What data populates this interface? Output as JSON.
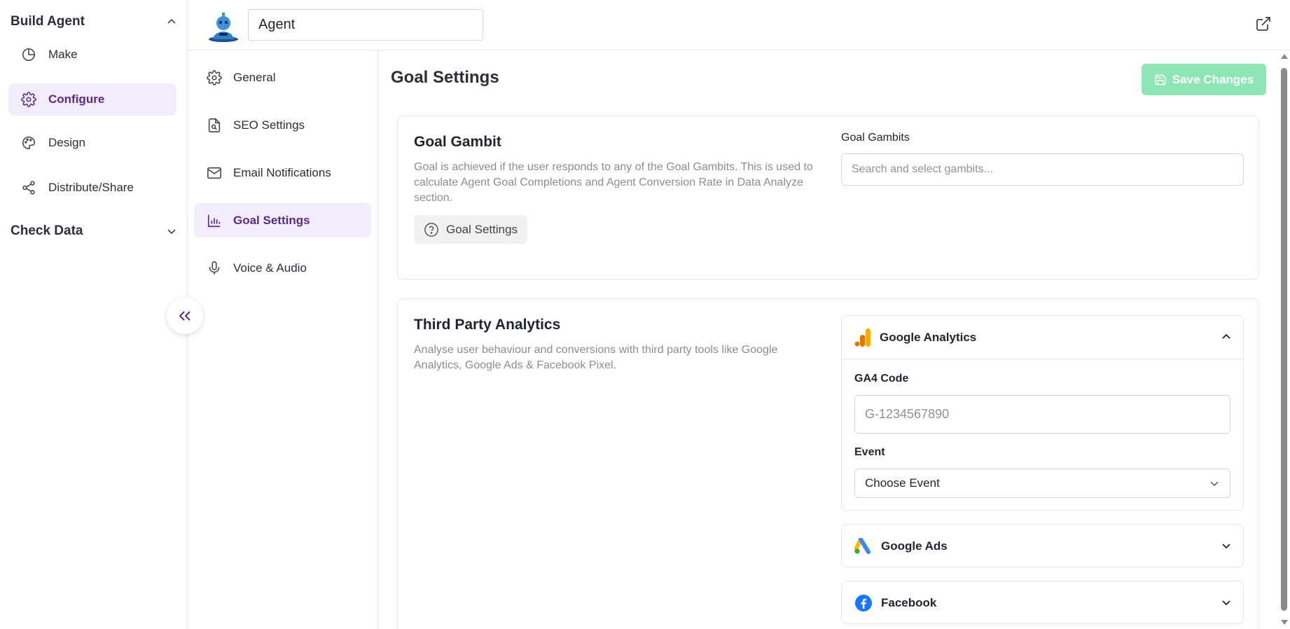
{
  "sidebar": {
    "build_agent": {
      "title": "Build Agent",
      "chevron_icon": "chevron-up-icon"
    },
    "items": [
      {
        "label": "Make",
        "icon": "pie-chart-icon"
      },
      {
        "label": "Configure",
        "icon": "gear-icon",
        "active": true
      },
      {
        "label": "Design",
        "icon": "palette-icon"
      },
      {
        "label": "Distribute/Share",
        "icon": "share-icon"
      }
    ],
    "check_data": {
      "title": "Check Data",
      "chevron_icon": "chevron-down-icon"
    },
    "collapse_icon": "double-chevron-left-icon"
  },
  "topbar": {
    "agent_name": "Agent",
    "avatar_icon": "robot-avatar-icon",
    "external_icon": "external-link-icon"
  },
  "settings_nav": {
    "items": [
      {
        "label": "General",
        "icon": "gear-icon"
      },
      {
        "label": "SEO Settings",
        "icon": "file-search-icon"
      },
      {
        "label": "Email Notifications",
        "icon": "mail-icon"
      },
      {
        "label": "Goal Settings",
        "icon": "bar-chart-icon",
        "active": true
      },
      {
        "label": "Voice & Audio",
        "icon": "microphone-icon"
      }
    ]
  },
  "main": {
    "title": "Goal Settings",
    "save_button": "Save Changes",
    "goal_gambit": {
      "title": "Goal Gambit",
      "description": "Goal is achieved if the user responds to any of the Goal Gambits. This is used to calculate Agent Goal Completions and Agent Conversion Rate in Data Analyze section.",
      "help_chip": "Goal Settings",
      "field_label": "Goal Gambits",
      "field_placeholder": "Search and select gambits..."
    },
    "third_party": {
      "title": "Third Party Analytics",
      "description": "Analyse user behaviour and conversions with third party tools like Google Analytics, Google Ads & Facebook Pixel.",
      "google_analytics": {
        "name": "Google Analytics",
        "ga4_label": "GA4 Code",
        "ga4_placeholder": "G-1234567890",
        "event_label": "Event",
        "event_value": "Choose Event"
      },
      "google_ads": {
        "name": "Google Ads"
      },
      "facebook": {
        "name": "Facebook"
      }
    }
  },
  "colors": {
    "accent_purple": "#5b2a86",
    "active_bg": "#f3ecfb",
    "save_green": "#8ee6b4"
  }
}
